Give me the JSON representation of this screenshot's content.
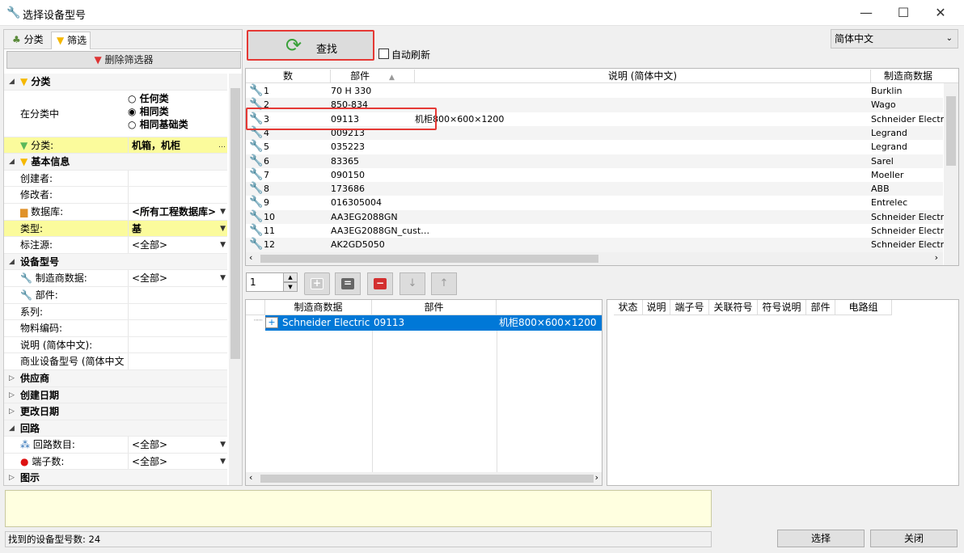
{
  "window": {
    "title": "选择设备型号"
  },
  "left_panel": {
    "tabs": [
      "分类",
      "筛选"
    ],
    "clear_filter_label": "删除筛选器",
    "sections": {
      "category": "分类",
      "basic_info": "基本信息",
      "device_model": "设备型号",
      "supplier": "供应商",
      "created_date": "创建日期",
      "modified_date": "更改日期",
      "circuit": "回路",
      "graphic": "图示"
    },
    "in_category_label": "在分类中",
    "radio_options": [
      "任何类",
      "相同类",
      "相同基础类"
    ],
    "category_field": {
      "label": "分类:",
      "value": "机箱，机柜"
    },
    "creator_label": "创建者:",
    "modifier_label": "修改者:",
    "database": {
      "label": "数据库:",
      "value": "<所有工程数据库>"
    },
    "type": {
      "label": "类型:",
      "value": "基"
    },
    "annotation_source": {
      "label": "标注源:",
      "value": "<全部>"
    },
    "manufacturer": {
      "label": "制造商数据:",
      "value": "<全部>"
    },
    "part_label": "部件:",
    "series_label": "系列:",
    "material_code_label": "物料编码:",
    "desc_label": "说明 (简体中文):",
    "commercial_model_label": "商业设备型号 (简体中文",
    "circuit_count": {
      "label": "回路数目:",
      "value": "<全部>"
    },
    "terminal_count": {
      "label": "端子数:",
      "value": "<全部>"
    }
  },
  "toolbar": {
    "find_label": "查找",
    "auto_refresh_label": "自动刷新",
    "language": "简体中文",
    "spin_value": "1"
  },
  "result_grid": {
    "columns": [
      "数",
      "部件",
      "说明 (简体中文)",
      "制造商数据"
    ],
    "rows": [
      [
        "1",
        "70 H 330",
        "",
        "Burklin"
      ],
      [
        "2",
        "850-834",
        "",
        "Wago"
      ],
      [
        "3",
        "09113",
        "机柜800×600×1200",
        "Schneider Electric"
      ],
      [
        "4",
        "009213",
        "",
        "Legrand"
      ],
      [
        "5",
        "035223",
        "",
        "Legrand"
      ],
      [
        "6",
        "83365",
        "",
        "Sarel"
      ],
      [
        "7",
        "090150",
        "",
        "Moeller"
      ],
      [
        "8",
        "173686",
        "",
        "ABB"
      ],
      [
        "9",
        "016305004",
        "",
        "Entrelec"
      ],
      [
        "10",
        "AA3EG2088GN",
        "",
        "Schneider Electric"
      ],
      [
        "11",
        "AA3EG2088GN_cust…",
        "",
        "Schneider Electric"
      ],
      [
        "12",
        "AK2GD5050",
        "",
        "Schneider Electric"
      ]
    ]
  },
  "selected_table": {
    "columns": [
      "制造商数据",
      "部件",
      ""
    ],
    "rows": [
      [
        "Schneider Electric",
        "09113",
        "机柜800×600×1200"
      ]
    ]
  },
  "detail_table": {
    "columns": [
      "状态",
      "说明",
      "端子号",
      "关联符号",
      "符号说明",
      "部件",
      "电路组"
    ]
  },
  "status_text": "找到的设备型号数: 24",
  "buttons": {
    "select": "选择",
    "close": "关闭"
  }
}
